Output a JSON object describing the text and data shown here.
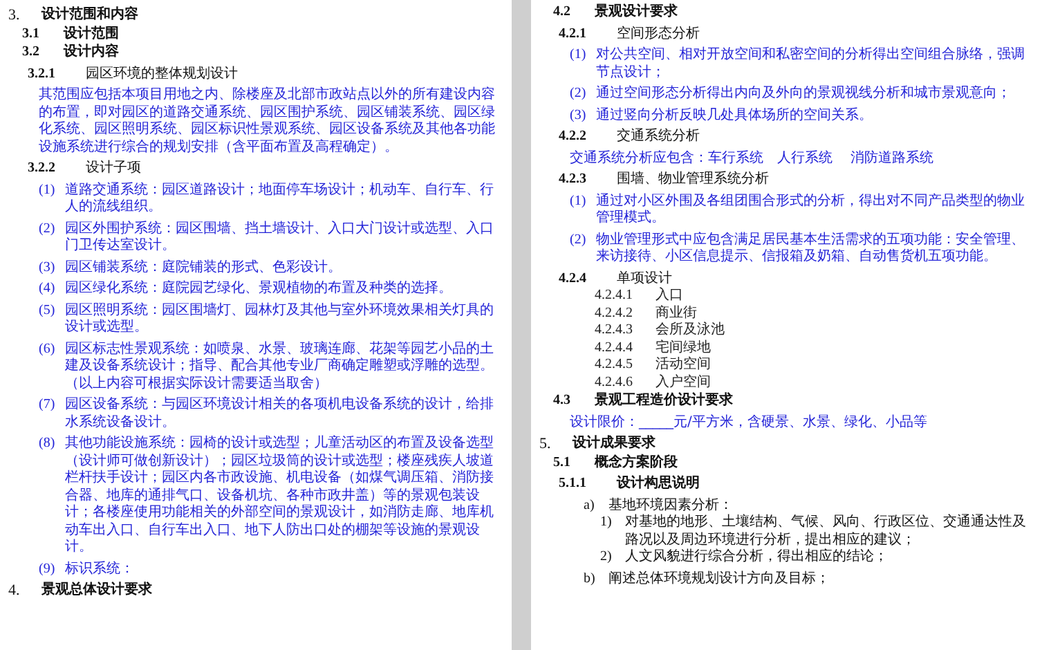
{
  "pages": [
    {
      "blocks": [
        {
          "kind": "h1",
          "number": "3.",
          "text": "设计范围和内容"
        },
        {
          "kind": "h2",
          "number": "3.1",
          "text": "设计范围"
        },
        {
          "kind": "h2",
          "number": "3.2",
          "text": "设计内容"
        },
        {
          "kind": "h3",
          "number": "3.2.1",
          "text": "园区环境的整体规划设计",
          "bold": false
        },
        {
          "kind": "para",
          "text": "其范围应包括本项目用地之内、除楼座及北部市政站点以外的所有建设内容的布置，即对园区的道路交通系统、园区围护系统、园区铺装系统、园区绿化系统、园区照明系统、园区标识性景观系统、园区设备系统及其他各功能设施系统进行综合的规划安排（含平面布置及高程确定）。"
        },
        {
          "kind": "h3",
          "number": "3.2.2",
          "text": "设计子项",
          "bold": false
        },
        {
          "kind": "item",
          "number": "(1)",
          "text": "道路交通系统：园区道路设计；地面停车场设计；机动车、自行车、行人的流线组织。"
        },
        {
          "kind": "item",
          "number": "(2)",
          "text": "园区外围护系统：园区围墙、挡土墙设计、入口大门设计或选型、入口门卫传达室设计。"
        },
        {
          "kind": "item",
          "number": "(3)",
          "text": "园区铺装系统：庭院铺装的形式、色彩设计。"
        },
        {
          "kind": "item",
          "number": "(4)",
          "text": "园区绿化系统：庭院园艺绿化、景观植物的布置及种类的选择。"
        },
        {
          "kind": "item",
          "number": "(5)",
          "text": "园区照明系统：园区围墙灯、园林灯及其他与室外环境效果相关灯具的设计或选型。"
        },
        {
          "kind": "item",
          "number": "(6)",
          "text": "园区标志性景观系统：如喷泉、水景、玻璃连廊、花架等园艺小品的土建及设备系统设计；指导、配合其他专业厂商确定雕塑或浮雕的选型。（以上内容可根据实际设计需要适当取舍）"
        },
        {
          "kind": "item",
          "number": "(7)",
          "text": "园区设备系统：与园区环境设计相关的各项机电设备系统的设计，给排水系统设备设计。"
        },
        {
          "kind": "item",
          "number": "(8)",
          "text": "其他功能设施系统：园椅的设计或选型；儿童活动区的布置及设备选型（设计师可做创新设计）；园区垃圾筒的设计或选型；楼座残疾人坡道栏杆扶手设计；园区内各市政设施、机电设备（如煤气调压箱、消防接合器、地库的通排气口、设备机坑、各种市政井盖）等的景观包装设计；各楼座使用功能相关的外部空间的景观设计，如消防走廊、地库机动车出入口、自行车出入口、地下人防出口处的棚架等设施的景观设计。"
        },
        {
          "kind": "item",
          "number": "(9)",
          "text": "标识系统："
        },
        {
          "kind": "h1",
          "number": "4.",
          "text": "景观总体设计要求"
        }
      ]
    },
    {
      "blocks": [
        {
          "kind": "h2",
          "number": "4.2",
          "text": "景观设计要求"
        },
        {
          "kind": "h3",
          "number": "4.2.1",
          "text": "空间形态分析",
          "bold": false
        },
        {
          "kind": "item",
          "number": "(1)",
          "text": "对公共空间、相对开放空间和私密空间的分析得出空间组合脉络，强调节点设计；"
        },
        {
          "kind": "item",
          "number": "(2)",
          "text": "通过空间形态分析得出内向及外向的景观视线分析和城市景观意向；"
        },
        {
          "kind": "item",
          "number": "(3)",
          "text": "通过竖向分析反映几处具体场所的空间关系。"
        },
        {
          "kind": "h3",
          "number": "4.2.2",
          "text": "交通系统分析",
          "bold": false
        },
        {
          "kind": "para",
          "text": "交通系统分析应包含：车行系统　人行系统　 消防道路系统"
        },
        {
          "kind": "h3",
          "number": "4.2.3",
          "text": "围墙、物业管理系统分析",
          "bold": false
        },
        {
          "kind": "item",
          "number": "(1)",
          "text": "通过对小区外围及各组团围合形式的分析，得出对不同产品类型的物业管理模式。"
        },
        {
          "kind": "item",
          "number": "(2)",
          "text": "物业管理形式中应包含满足居民基本生活需求的五项功能：安全管理、来访接待、小区信息提示、信报箱及奶箱、自动售货机五项功能。"
        },
        {
          "kind": "h3",
          "number": "4.2.4",
          "text": "单项设计",
          "bold": false
        },
        {
          "kind": "h4",
          "number": "4.2.4.1",
          "text": "入口"
        },
        {
          "kind": "h4",
          "number": "4.2.4.2",
          "text": "商业街"
        },
        {
          "kind": "h4",
          "number": "4.2.4.3",
          "text": "会所及泳池"
        },
        {
          "kind": "h4",
          "number": "4.2.4.4",
          "text": "宅间绿地"
        },
        {
          "kind": "h4",
          "number": "4.2.4.5",
          "text": "活动空间"
        },
        {
          "kind": "h4",
          "number": "4.2.4.6",
          "text": "入户空间"
        },
        {
          "kind": "h2",
          "number": "4.3",
          "text": "景观工程造价设计要求"
        },
        {
          "kind": "para",
          "text": "设计限价：_____元/平方米，含硬景、水景、绿化、小品等"
        },
        {
          "kind": "h1",
          "number": "5.",
          "text": "设计成果要求"
        },
        {
          "kind": "h2",
          "number": "5.1",
          "text": "概念方案阶段"
        },
        {
          "kind": "h3",
          "number": "5.1.1",
          "text": "设计构思说明",
          "bold": true
        },
        {
          "kind": "alpha",
          "number": "a)",
          "text": "基地环境因素分析："
        },
        {
          "kind": "sub",
          "number": "1)",
          "text": "对基地的地形、土壤结构、气候、风向、行政区位、交通通达性及路况以及周边环境进行分析，提出相应的建议；"
        },
        {
          "kind": "sub",
          "number": "2)",
          "text": "人文风貌进行综合分析，得出相应的结论；"
        },
        {
          "kind": "alpha",
          "number": "b)",
          "text": "阐述总体环境规划设计方向及目标；"
        }
      ]
    }
  ]
}
